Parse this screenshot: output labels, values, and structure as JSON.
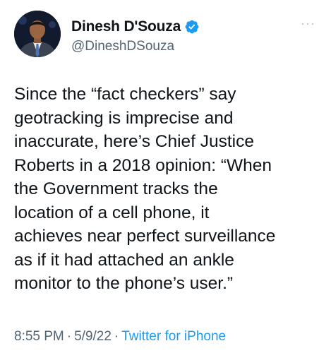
{
  "author": {
    "display_name": "Dinesh D'Souza",
    "handle": "@DineshDSouza",
    "verified": true,
    "avatar_icon": "profile-photo",
    "verified_icon": "verified-badge-icon"
  },
  "tweet": {
    "text": "Since the “fact checkers” say\ngeotracking is imprecise and\ninaccurate, here’s Chief Justice\nRoberts in a 2018 opinion: “When\nthe Government tracks the\nlocation of a cell phone, it\nachieves near perfect surveillance\nas if it had attached an ankle\nmonitor to the phone’s user.”",
    "time": "8:55 PM",
    "date": "5/9/22",
    "separator": "·",
    "source": "Twitter for iPhone"
  },
  "more_label": "···",
  "colors": {
    "text": "#0f1419",
    "secondary": "#536471",
    "accent": "#1d9bf0"
  }
}
